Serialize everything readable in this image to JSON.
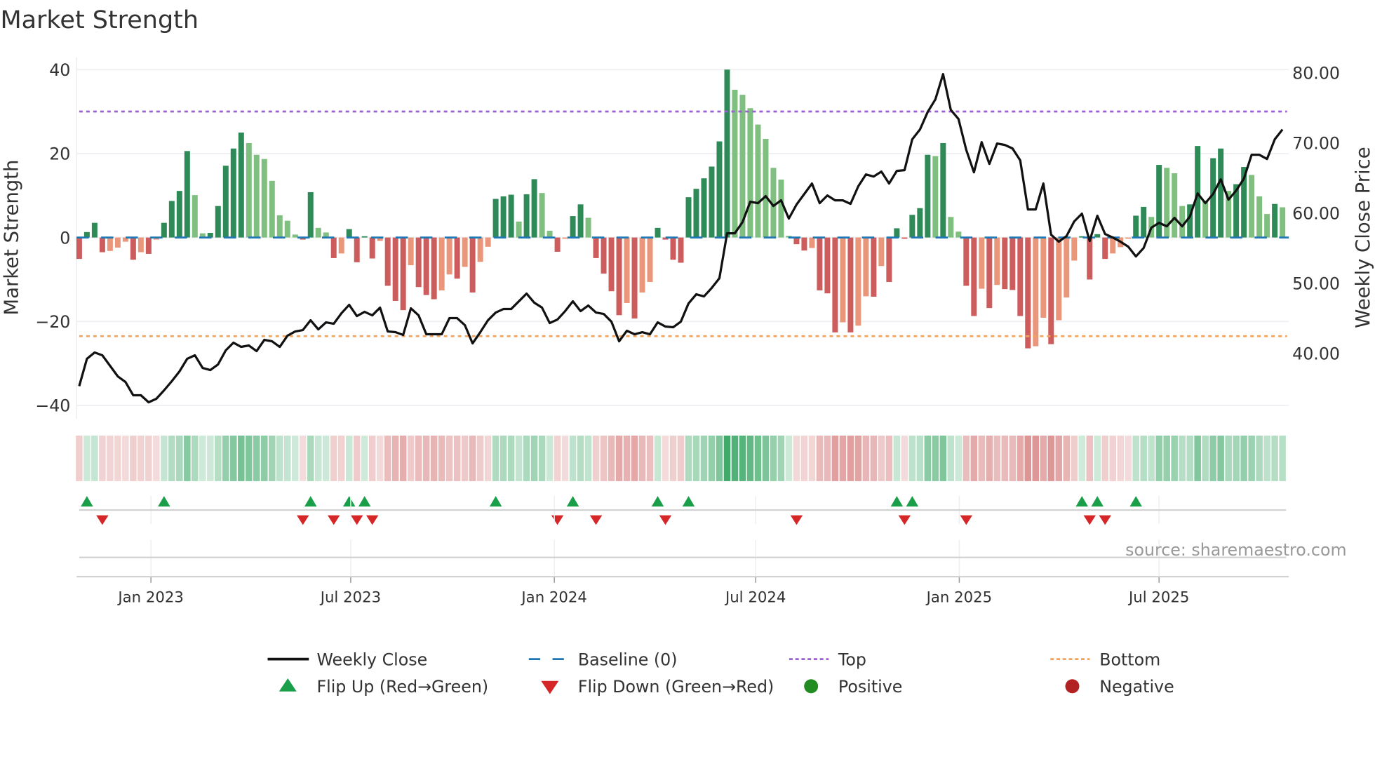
{
  "chart_data": {
    "type": "bar",
    "title": "Market Strength",
    "ylabel": "Market Strength",
    "y2label": "Weekly Close Price",
    "ylim": [
      -42,
      40
    ],
    "y2lim": [
      29.5,
      80.5
    ],
    "yticks": [
      "40",
      "20",
      "0",
      "−20",
      "−40"
    ],
    "ytick_values": [
      40,
      20,
      0,
      -20,
      -40
    ],
    "y2ticks": [
      "80.00",
      "70.00",
      "60.00",
      "50.00",
      "40.00"
    ],
    "y2tick_values": [
      80,
      70,
      60,
      50,
      40
    ],
    "xticks": [
      {
        "label": "Jan 2023",
        "week": 10.3
      },
      {
        "label": "Jul 2023",
        "week": 36.2
      },
      {
        "label": "Jan 2024",
        "week": 62.6
      },
      {
        "label": "Jul 2024",
        "week": 88.7
      },
      {
        "label": "Jan 2025",
        "week": 115.1
      },
      {
        "label": "Jul 2025",
        "week": 141.0
      }
    ],
    "top_level": 30,
    "bottom_level": -23.5,
    "baseline": 0,
    "grid": true,
    "legend_position": "bottom",
    "source": "source: sharemaestro.com",
    "strength": [
      -5.1,
      1.3,
      3.5,
      -3.5,
      -3.2,
      -2.4,
      -1.0,
      -5.3,
      -3.5,
      -3.9,
      -0.5,
      3.5,
      8.7,
      11.1,
      20.6,
      10.1,
      1.0,
      1.1,
      7.5,
      17.1,
      21.2,
      25.0,
      22.5,
      19.7,
      18.7,
      13.5,
      5.3,
      4.0,
      0.7,
      -0.5,
      10.8,
      2.3,
      1.2,
      -4.9,
      -3.8,
      2.0,
      -5.9,
      0.3,
      -5.0,
      -0.8,
      -11.5,
      -15.1,
      -17.3,
      -6.6,
      -11.8,
      -13.7,
      -14.7,
      -12.6,
      -8.8,
      -9.8,
      -7.0,
      -13.1,
      -5.8,
      -2.2,
      9.2,
      9.8,
      10.2,
      3.8,
      10.3,
      13.9,
      10.6,
      1.6,
      -3.4,
      -0.3,
      5.1,
      7.9,
      4.7,
      -4.9,
      -8.6,
      -12.8,
      -18.5,
      -15.6,
      -19.3,
      -13.1,
      -10.6,
      2.3,
      -0.5,
      -5.3,
      -6.0,
      9.6,
      11.6,
      14.1,
      16.9,
      22.9,
      40.0,
      35.2,
      34.0,
      30.8,
      26.9,
      23.5,
      16.6,
      13.8,
      0.4,
      -1.6,
      -3.1,
      -2.5,
      -12.6,
      -13.3,
      -22.6,
      -20.2,
      -22.6,
      -21.0,
      -14.0,
      -14.1,
      -6.8,
      -10.6,
      2.2,
      -0.3,
      5.4,
      7.0,
      19.7,
      19.4,
      22.5,
      4.9,
      1.4,
      -11.5,
      -18.7,
      -12.2,
      -16.8,
      -11.3,
      -12.3,
      -12.5,
      -18.7,
      -26.4,
      -25.9,
      -19.1,
      -25.4,
      -19.7,
      -14.3,
      -5.5,
      0.3,
      -10.0,
      0.8,
      -5.1,
      -3.8,
      -2.3,
      -0.3,
      5.2,
      7.3,
      4.9,
      17.3,
      16.6,
      15.3,
      7.5,
      7.9,
      21.8,
      8.8,
      18.9,
      21.2,
      11.1,
      12.7,
      16.8,
      14.9,
      9.8,
      5.6,
      8.0,
      7.2
    ],
    "weekly_close": [
      35.3,
      39.2,
      40.1,
      39.7,
      38.2,
      36.7,
      35.9,
      34.0,
      34.0,
      33.0,
      33.5,
      34.7,
      36.0,
      37.4,
      39.2,
      39.7,
      37.9,
      37.6,
      38.4,
      40.4,
      41.5,
      40.9,
      41.1,
      40.3,
      41.9,
      41.7,
      40.9,
      42.5,
      43.1,
      43.3,
      44.7,
      43.4,
      44.4,
      44.2,
      45.7,
      46.9,
      45.3,
      45.9,
      45.4,
      46.5,
      43.1,
      43.0,
      42.6,
      46.4,
      45.4,
      42.7,
      42.7,
      42.7,
      45.0,
      45.0,
      44.0,
      41.4,
      43.0,
      44.7,
      45.8,
      46.3,
      46.3,
      47.4,
      48.5,
      47.2,
      46.5,
      44.3,
      44.8,
      46.0,
      47.4,
      46.0,
      46.8,
      45.8,
      45.6,
      44.5,
      41.7,
      43.2,
      42.7,
      43.0,
      42.7,
      44.4,
      43.8,
      43.7,
      44.5,
      47.1,
      48.4,
      48.1,
      49.3,
      50.7,
      57.1,
      57.1,
      58.7,
      61.6,
      61.4,
      62.4,
      61.0,
      61.8,
      59.2,
      61.2,
      62.7,
      64.2,
      61.4,
      62.5,
      61.8,
      61.8,
      61.3,
      63.8,
      65.5,
      65.2,
      65.9,
      64.2,
      66.0,
      66.1,
      70.5,
      71.9,
      74.4,
      76.2,
      79.8,
      74.7,
      73.4,
      69.0,
      65.8,
      70.1,
      67.0,
      69.9,
      69.7,
      69.2,
      67.5,
      60.5,
      60.5,
      64.2,
      56.9,
      55.9,
      56.7,
      58.8,
      59.9,
      56.0,
      59.6,
      57.0,
      56.5,
      55.9,
      55.2,
      53.8,
      55.0,
      57.9,
      58.6,
      58.1,
      59.3,
      58.1,
      59.5,
      62.8,
      61.4,
      62.7,
      64.8,
      61.9,
      63.2,
      64.9,
      68.3,
      68.3,
      67.7,
      70.5,
      71.9
    ],
    "legend": [
      {
        "label": "Weekly Close",
        "symbol": "line"
      },
      {
        "label": "Baseline (0)",
        "symbol": "dash"
      },
      {
        "label": "Top",
        "symbol": "dots"
      },
      {
        "label": "Bottom",
        "symbol": "dots"
      },
      {
        "label": "Flip Up (Red→Green)",
        "symbol": "triangle-up"
      },
      {
        "label": "Flip Down (Green→Red)",
        "symbol": "triangle-down"
      },
      {
        "label": "Positive",
        "symbol": "circle"
      },
      {
        "label": "Negative",
        "symbol": "circle"
      }
    ],
    "colors": {
      "rising_positive": "#2e8b57",
      "falling_positive": "#7fbf7f",
      "rising_negative": "#cd5c5c",
      "falling_negative": "#e9967a",
      "line": "#111111",
      "baseline": "#1f77b4",
      "top": "#9b5fd6",
      "bottom": "#f2a35e",
      "flip_up": "#1a9e4a",
      "flip_down": "#d62728",
      "positive": "#228b22",
      "negative": "#b22222"
    }
  }
}
